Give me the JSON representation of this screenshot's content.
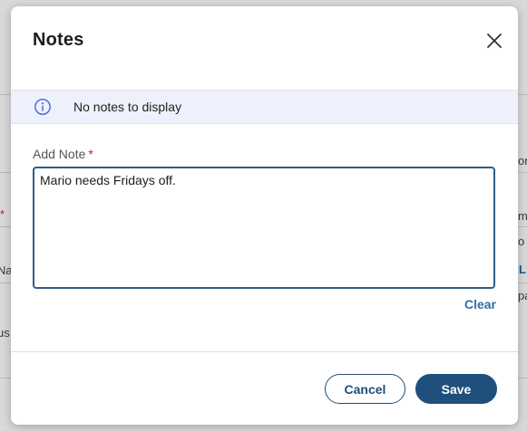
{
  "dialog": {
    "title": "Notes",
    "close_icon": "close-icon"
  },
  "info_banner": {
    "icon": "info-icon",
    "text": "No notes to display"
  },
  "add_note": {
    "label": "Add Note",
    "required_marker": "*",
    "value": "Mario needs Fridays off."
  },
  "clear_link": "Clear",
  "buttons": {
    "cancel": "Cancel",
    "save": "Save"
  },
  "background_fragments": {
    "right_1": "or",
    "left_req": "*",
    "right_2": "m",
    "right_3": "o",
    "left_1": "Na",
    "right_link": "L",
    "right_4": "pa",
    "left_2": "us"
  },
  "colors": {
    "primary": "#1f4f7d",
    "link": "#2f6da3",
    "required": "#b3261e",
    "banner_bg": "#eef1fb"
  }
}
